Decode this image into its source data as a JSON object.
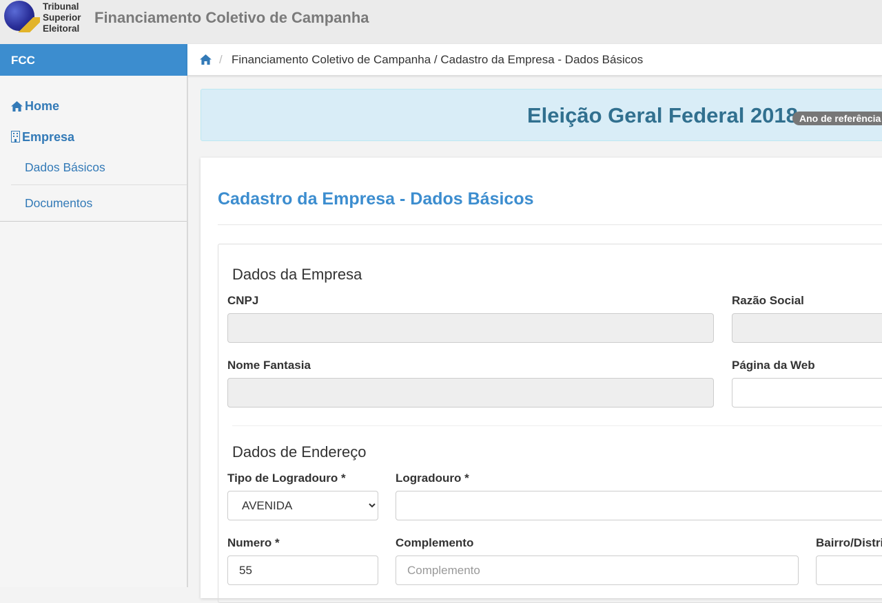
{
  "header": {
    "logo_lines": [
      "Tribunal",
      "Superior",
      "Eleitoral"
    ],
    "app_title": "Financiamento Coletivo de Campanha"
  },
  "brand": {
    "label": "FCC"
  },
  "breadcrumb": {
    "home_icon": "home-icon",
    "separator": "/",
    "path": "Financiamento Coletivo de Campanha / Cadastro da Empresa - Dados Básicos"
  },
  "sidebar": {
    "home": "Home",
    "empresa": "Empresa",
    "items": [
      "Dados Básicos",
      "Documentos"
    ]
  },
  "banner": {
    "title": "Eleição Geral Federal 2018",
    "badge": "Ano de referência"
  },
  "page": {
    "title": "Cadastro da Empresa - Dados Básicos"
  },
  "empresa_section": {
    "title": "Dados da Empresa",
    "cnpj_label": "CNPJ",
    "cnpj_value": "",
    "razao_label": "Razão Social",
    "razao_value": "",
    "fantasia_label": "Nome Fantasia",
    "fantasia_value": "",
    "web_label": "Página da Web",
    "web_value": ""
  },
  "endereco_section": {
    "title": "Dados de Endereço",
    "tipo_label": "Tipo de Logradouro *",
    "tipo_selected": "AVENIDA",
    "logradouro_label": "Logradouro *",
    "logradouro_value": "",
    "numero_label": "Numero *",
    "numero_value": "55",
    "complemento_label": "Complemento",
    "complemento_placeholder": "Complemento",
    "bairro_label": "Bairro/Distrito *",
    "bairro_value": ""
  },
  "colors": {
    "primary": "#3c8dcf",
    "link": "#337ab7",
    "banner_bg": "#d9edf7",
    "banner_text": "#31708f"
  }
}
